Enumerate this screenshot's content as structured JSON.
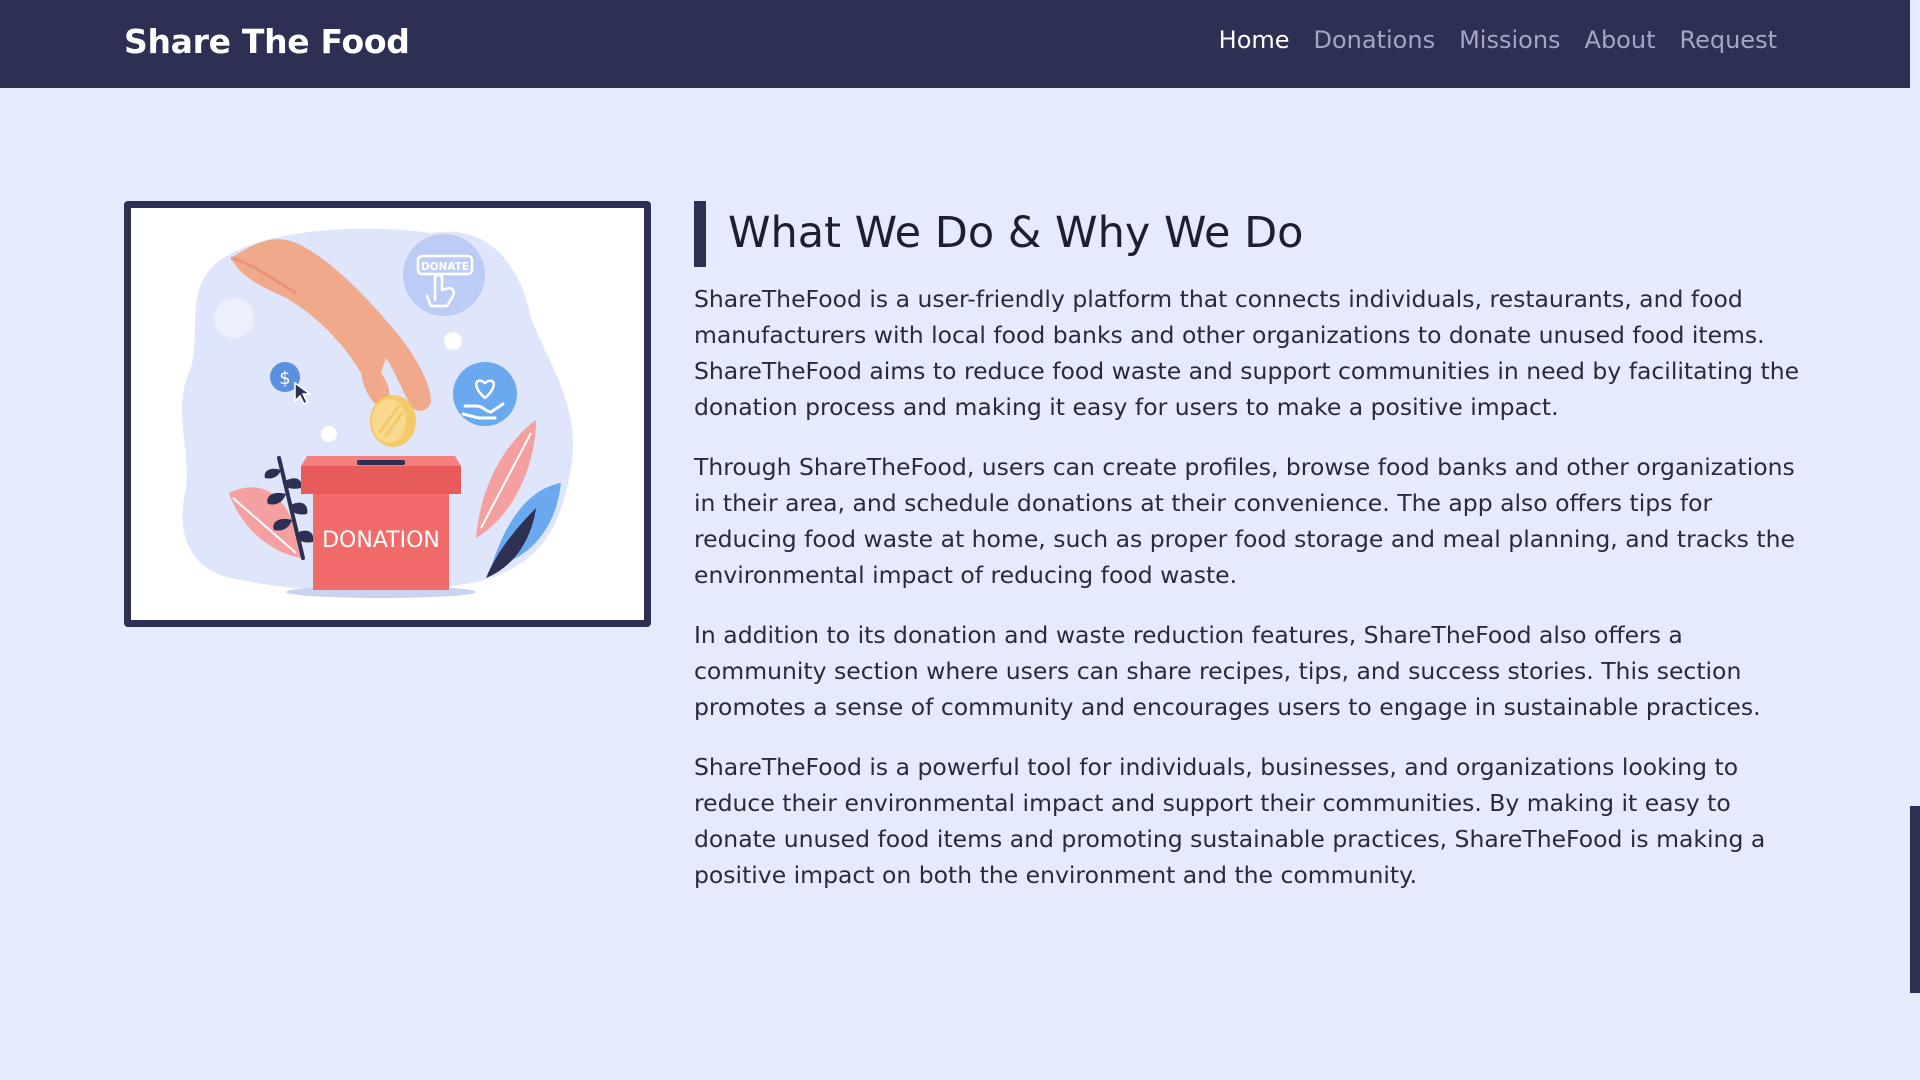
{
  "nav": {
    "brand": "Share The Food",
    "links": [
      "Home",
      "Donations",
      "Missions",
      "About",
      "Request"
    ],
    "active": "Home"
  },
  "illustration": {
    "donate_badge": "DONATE",
    "box_label": "DONATION",
    "coin_symbol": "$"
  },
  "main": {
    "heading": "What We Do & Why We Do",
    "paragraphs": [
      "ShareTheFood is a user-friendly platform that connects individuals, restaurants, and food manufacturers with local food banks and other organizations to donate unused food items. ShareTheFood aims to reduce food waste and support communities in need by facilitating the donation process and making it easy for users to make a positive impact.",
      "Through ShareTheFood, users can create profiles, browse food banks and other organizations in their area, and schedule donations at their convenience. The app also offers tips for reducing food waste at home, such as proper food storage and meal planning, and tracks the environmental impact of reducing food waste.",
      "In addition to its donation and waste reduction features, ShareTheFood also offers a community section where users can share recipes, tips, and success stories. This section promotes a sense of community and encourages users to engage in sustainable practices.",
      "ShareTheFood is a powerful tool for individuals, businesses, and organizations looking to reduce their environmental impact and support their communities. By making it easy to donate unused food items and promoting sustainable practices, ShareTheFood is making a positive impact on both the environment and the community."
    ]
  },
  "colors": {
    "navbar": "#2d2f53",
    "page_bg": "#e5ebfc",
    "accent_bar": "#2d2f53",
    "donation_box": "#f26b6b",
    "blob": "#dfe6fb"
  }
}
